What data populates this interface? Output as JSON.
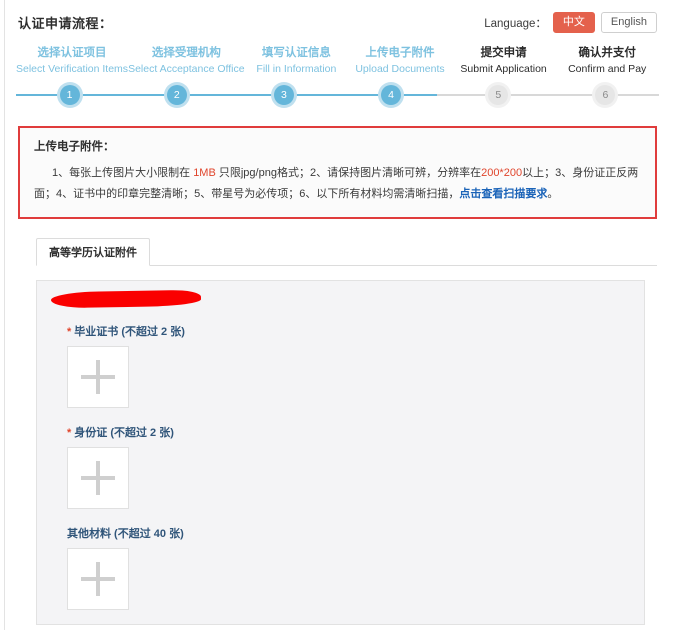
{
  "header": {
    "title": "认证申请流程：",
    "language_label": "Language：",
    "lang_active": "中文",
    "lang_inactive": "English",
    "accent_color": "#e4614c"
  },
  "stepper": {
    "active_color": "#64b6da",
    "inactive_color": "#e6e6e6",
    "steps": [
      {
        "num": "1",
        "cn": "选择认证项目",
        "en": "Select Verification Items",
        "state": "done"
      },
      {
        "num": "2",
        "cn": "选择受理机构",
        "en": "Select Acceptance Office",
        "state": "done"
      },
      {
        "num": "3",
        "cn": "填写认证信息",
        "en": "Fill in Information",
        "state": "done"
      },
      {
        "num": "4",
        "cn": "上传电子附件",
        "en": "Upload Documents",
        "state": "done"
      },
      {
        "num": "5",
        "cn": "提交申请",
        "en": "Submit Application",
        "state": "todo"
      },
      {
        "num": "6",
        "cn": "确认并支付",
        "en": "Confirm and Pay",
        "state": "todo"
      }
    ]
  },
  "notice": {
    "border_color": "#e03c3c",
    "title": "上传电子附件：",
    "seg_1": "1、每张上传图片大小限制在 ",
    "hl_1": "1MB",
    "seg_2": " 只限jpg/png格式；2、请保持图片清晰可辨，分辨率在",
    "hl_2": "200*200",
    "seg_3": "以上；3、身份证正反两面；4、证书中的印章完整清晰；5、带星号为必传项；6、以下所有材料均需清晰扫描，",
    "link": "点击查看扫描要求",
    "seg_4": "。"
  },
  "tabs": [
    {
      "label": "高等学历认证附件",
      "active": true
    }
  ],
  "upload": {
    "groups": [
      {
        "required": true,
        "star": "*",
        "label": "毕业证书 (不超过 2 张)",
        "icon": "plus-icon"
      },
      {
        "required": true,
        "star": "*",
        "label": "身份证 (不超过 2 张)",
        "icon": "plus-icon"
      },
      {
        "required": false,
        "star": "",
        "label": "其他材料 (不超过 40 张)",
        "icon": "plus-icon"
      }
    ]
  }
}
